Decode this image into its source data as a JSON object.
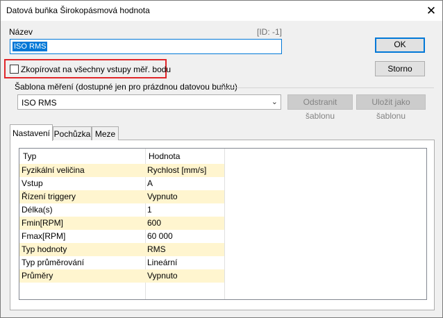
{
  "window": {
    "title": "Datová buňka Širokopásmová hodnota"
  },
  "name": {
    "label": "Název",
    "id_text": "[ID: -1]",
    "value": "ISO RMS"
  },
  "buttons": {
    "ok": "OK",
    "cancel": "Storno"
  },
  "copy_checkbox": {
    "label": "Zkopírovat na všechny vstupy měř. bodu",
    "checked": false
  },
  "template": {
    "group_label": "Šablona měření (dostupné jen pro prázdnou datovou buňku)",
    "selected": "ISO RMS",
    "remove_button": "Odstranit šablonu",
    "save_button": "Uložit jako šablonu"
  },
  "tabs": [
    {
      "label": "Nastavení",
      "active": true
    },
    {
      "label": "Pochůzka",
      "active": false
    },
    {
      "label": "Meze",
      "active": false
    }
  ],
  "grid": {
    "columns": [
      "Typ",
      "Hodnota"
    ],
    "rows": [
      {
        "type": "Fyzikální veličina",
        "value": "Rychlost [mm/s]",
        "highlighted": true
      },
      {
        "type": "Vstup",
        "value": "A",
        "highlighted": false
      },
      {
        "type": "Řízení triggery",
        "value": "Vypnuto",
        "highlighted": true
      },
      {
        "type": "Délka(s)",
        "value": "1",
        "highlighted": false
      },
      {
        "type": "Fmin[RPM]",
        "value": "600",
        "highlighted": true
      },
      {
        "type": "Fmax[RPM]",
        "value": "60 000",
        "highlighted": false
      },
      {
        "type": "Typ hodnoty",
        "value": "RMS",
        "highlighted": true
      },
      {
        "type": "Typ průměrování",
        "value": "Lineární",
        "highlighted": false
      },
      {
        "type": "Průměry",
        "value": "Vypnuto",
        "highlighted": true
      }
    ]
  },
  "colors": {
    "highlight_row": "#fff5cf",
    "accent": "#0078d7",
    "annotation_box": "#e0262a"
  }
}
